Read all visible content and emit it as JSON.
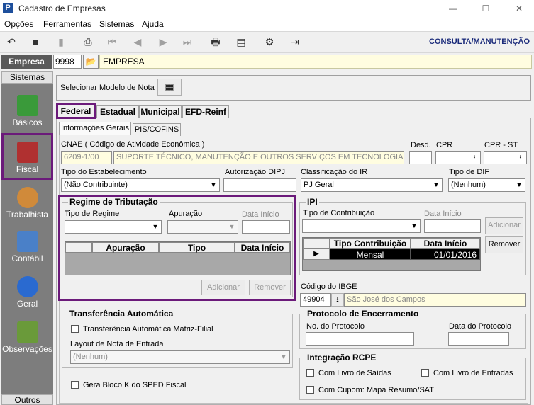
{
  "window": {
    "title": "Cadastro de Empresas",
    "minimize": "—",
    "maximize": "☐",
    "close": "✕"
  },
  "menu": [
    "Opções",
    "Ferramentas",
    "Sistemas",
    "Ajuda"
  ],
  "toolbar": {
    "mode_label": "CONSULTA/MANUTENÇÃO"
  },
  "empresa": {
    "label": "Empresa",
    "code": "9998",
    "name": "EMPRESA"
  },
  "sidebar": {
    "header": "Sistemas",
    "footer": "Outros",
    "items": [
      "Básicos",
      "Fiscal",
      "Trabalhista",
      "Contábil",
      "Geral",
      "Observações"
    ]
  },
  "modelo": {
    "label": "Selecionar Modelo de Nota"
  },
  "tabs": [
    "Federal",
    "Estadual",
    "Municipal",
    "EFD-Reinf"
  ],
  "subtabs": [
    "Informações Gerais",
    "PIS/COFINS"
  ],
  "cnae": {
    "label": "CNAE ( Código de  Atividade Econômica )",
    "code": "6209-1/00",
    "desc": "SUPORTE TÉCNICO, MANUTENÇÃO E OUTROS SERVIÇOS EM TECNOLOGIA DA"
  },
  "desd": {
    "label": "Desd."
  },
  "cpr": {
    "label": "CPR"
  },
  "cprst": {
    "label": "CPR - ST"
  },
  "tipo_estab": {
    "label": "Tipo do Estabelecimento",
    "value": "(Não Contribuinte)"
  },
  "aut_dipj": {
    "label": "Autorização DIPJ"
  },
  "class_ir": {
    "label": "Classificação do IR",
    "value": "PJ Geral"
  },
  "tipo_dif": {
    "label": "Tipo de DIF",
    "value": "(Nenhum)"
  },
  "regime": {
    "title": "Regime de Tributação",
    "tipo_label": "Tipo de Regime",
    "apuracao_label": "Apuração",
    "data_label": "Data Início",
    "cols": [
      "Apuração",
      "Tipo",
      "Data Início"
    ],
    "add": "Adicionar",
    "remove": "Remover"
  },
  "ipi": {
    "title": "IPI",
    "tipo_label": "Tipo de Contribuição",
    "data_label": "Data Início",
    "add": "Adicionar",
    "remove": "Remover",
    "cols": [
      "Tipo Contribuição",
      "Data Início"
    ],
    "row": {
      "tipo": "Mensal",
      "data": "01/01/2016"
    }
  },
  "ibge": {
    "label": "Código do IBGE",
    "code": "49904",
    "city": "São José dos Campos"
  },
  "transf": {
    "title": "Transferência Automática",
    "check_label": "Transferência Automática Matriz-Filial",
    "layout_label": "Layout de Nota de Entrada",
    "layout_value": "(Nenhum)"
  },
  "bloco_k": {
    "label": "Gera Bloco K do SPED Fiscal"
  },
  "protocolo": {
    "title": "Protocolo de Encerramento",
    "num_label": "No. do Protocolo",
    "data_label": "Data do Protocolo"
  },
  "rcpe": {
    "title": "Integração RCPE",
    "saidas": "Com Livro de Saídas",
    "entradas": "Com Livro de Entradas",
    "cupom": "Com Cupom: Mapa Resumo/SAT"
  }
}
